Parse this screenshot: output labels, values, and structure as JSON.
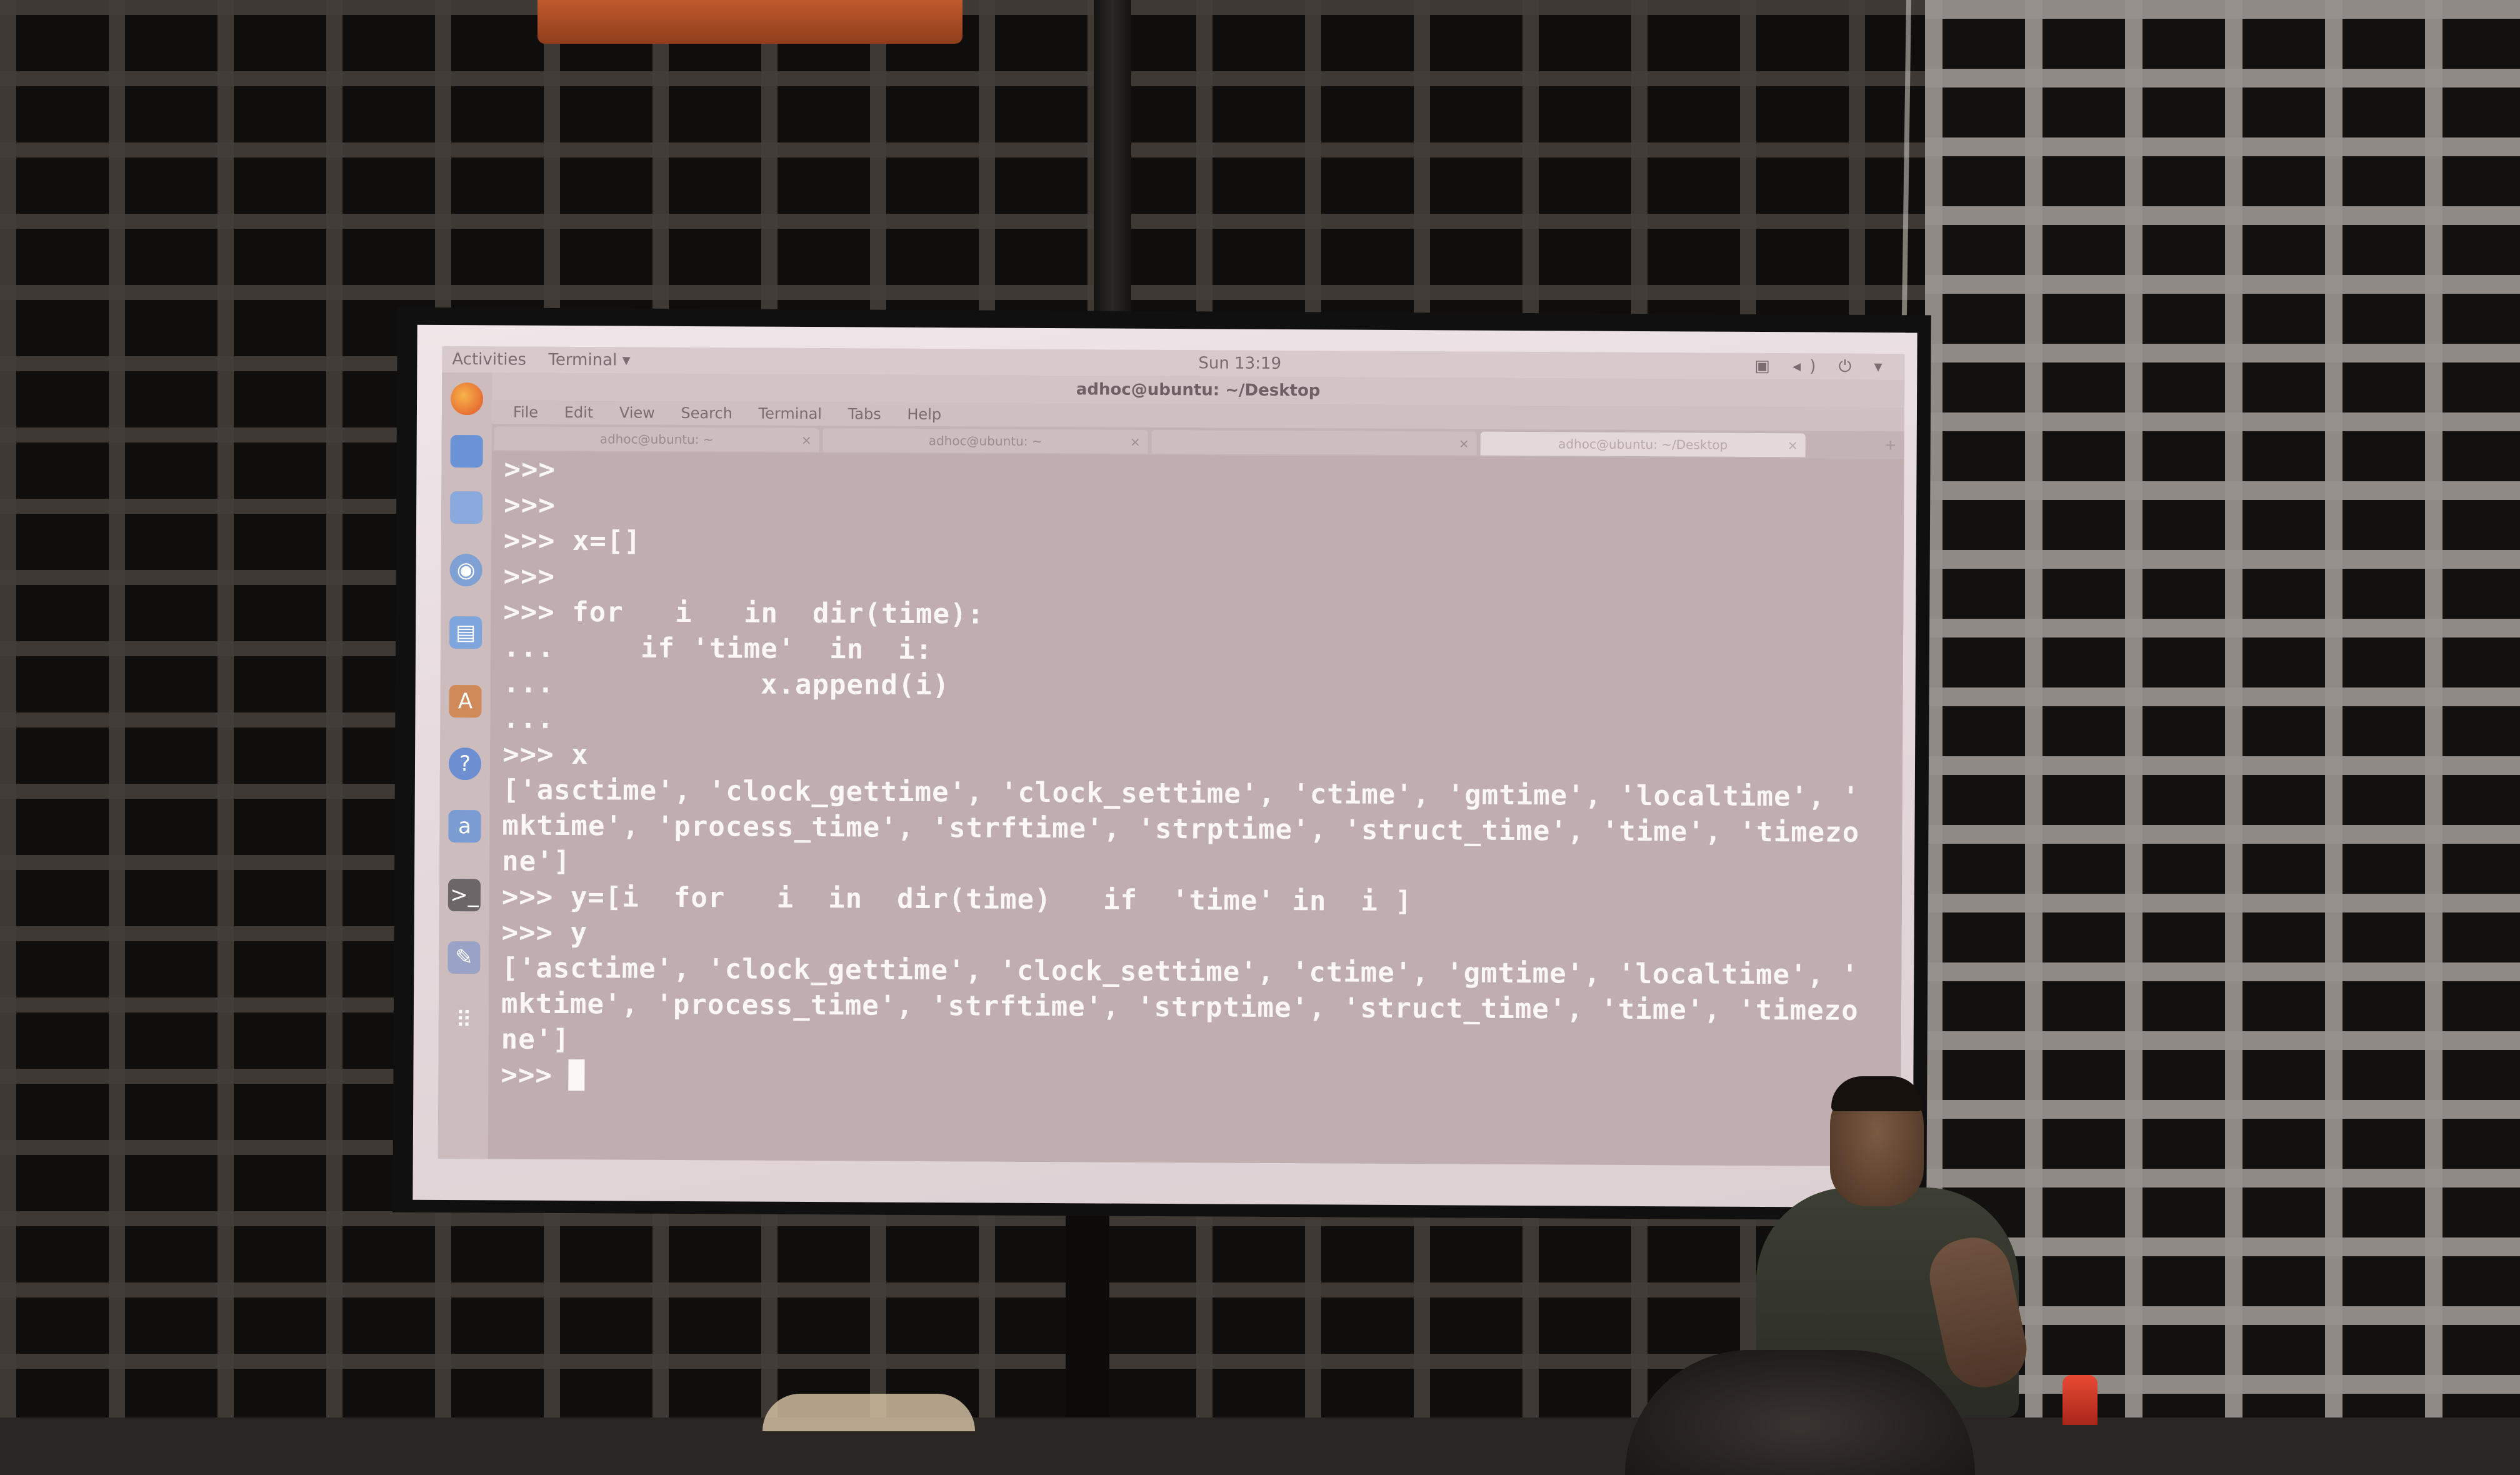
{
  "topbar": {
    "activities": "Activities",
    "app_menu": "Terminal ▾",
    "clock": "Sun 13:19"
  },
  "window": {
    "title": "adhoc@ubuntu: ~/Desktop"
  },
  "menubar": [
    "File",
    "Edit",
    "View",
    "Search",
    "Terminal",
    "Tabs",
    "Help"
  ],
  "tabs": [
    {
      "label": "adhoc@ubuntu: ~",
      "active": false
    },
    {
      "label": "adhoc@ubuntu: ~",
      "active": false
    },
    {
      "label": "",
      "active": false
    },
    {
      "label": "adhoc@ubuntu: ~/Desktop",
      "active": true
    }
  ],
  "dock_icons": [
    "firefox-icon",
    "files-icon",
    "files-cabinet-icon",
    "rhythmbox-icon",
    "libreoffice-writer-icon",
    "software-center-icon",
    "help-icon",
    "amazon-icon",
    "terminal-icon",
    "text-editor-icon",
    "app-grid-icon"
  ],
  "terminal": {
    "lines": [
      ">>>",
      ">>>",
      ">>> x=[]",
      ">>>",
      ">>> for   i   in  dir(time):",
      "...     if 'time'  in  i:",
      "...            x.append(i)",
      "...",
      ">>> x",
      "['asctime', 'clock_gettime', 'clock_settime', 'ctime', 'gmtime', 'localtime', '",
      "mktime', 'process_time', 'strftime', 'strptime', 'struct_time', 'time', 'timezo",
      "ne']",
      ">>> y=[i  for   i  in  dir(time)   if  'time' in  i ]",
      ">>> y",
      "['asctime', 'clock_gettime', 'clock_settime', 'ctime', 'gmtime', 'localtime', '",
      "mktime', 'process_time', 'strftime', 'strptime', 'struct_time', 'time', 'timezo",
      "ne']",
      ">>> "
    ]
  },
  "colors": {
    "screen_bg": "#bfadaf",
    "terminal_text": "#fbf7f7",
    "wall_frame": "#0f0d0c"
  }
}
